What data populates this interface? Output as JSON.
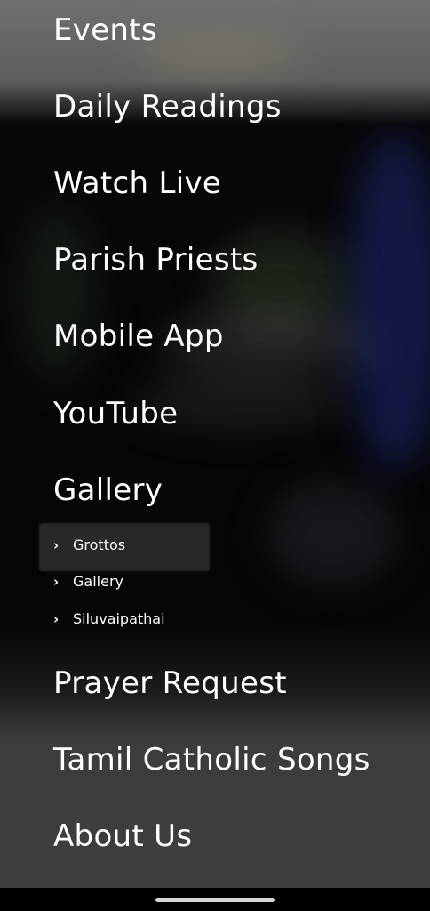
{
  "menu": {
    "items": [
      {
        "label": "Events"
      },
      {
        "label": "Daily Readings"
      },
      {
        "label": "Watch Live"
      },
      {
        "label": "Parish Priests"
      },
      {
        "label": "Mobile App"
      },
      {
        "label": "YouTube"
      },
      {
        "label": "Gallery"
      },
      {
        "label": "Prayer Request"
      },
      {
        "label": "Tamil Catholic Songs"
      },
      {
        "label": "About Us"
      }
    ],
    "gallery_subitems": [
      {
        "label": "Grottos",
        "icon": "chevron-right-icon"
      },
      {
        "label": "Gallery",
        "icon": "chevron-right-icon"
      },
      {
        "label": "Siluvaipathai",
        "icon": "chevron-right-icon"
      }
    ]
  },
  "colors": {
    "text": "#ffffff",
    "nav_handle": "#d6d6d6"
  }
}
